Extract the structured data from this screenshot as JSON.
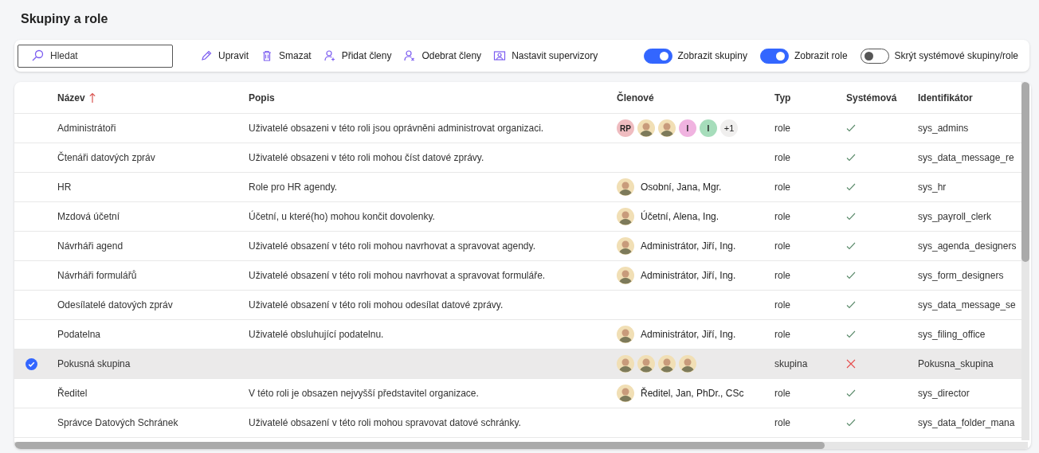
{
  "page": {
    "title": "Skupiny a role"
  },
  "toolbar": {
    "search": {
      "placeholder": "Hledat"
    },
    "actions": [
      {
        "kind": "edit",
        "label": "Upravit"
      },
      {
        "kind": "delete",
        "label": "Smazat"
      },
      {
        "kind": "add_members",
        "label": "Přidat členy"
      },
      {
        "kind": "remove_members",
        "label": "Odebrat členy"
      },
      {
        "kind": "supervisors",
        "label": "Nastavit supervizory"
      }
    ],
    "toggles": [
      {
        "label": "Zobrazit skupiny",
        "on": true
      },
      {
        "label": "Zobrazit role",
        "on": true
      },
      {
        "label": "Skrýt systémové skupiny/role",
        "on": false
      }
    ]
  },
  "table": {
    "columns": [
      {
        "label": "Název",
        "sorted": true
      },
      {
        "label": "Popis",
        "sorted": false
      },
      {
        "label": "Členové",
        "sorted": false
      },
      {
        "label": "Typ",
        "sorted": false
      },
      {
        "label": "Systémová",
        "sorted": false
      },
      {
        "label": "Identifikátor",
        "sorted": false
      }
    ],
    "rows": [
      {
        "selected": false,
        "name": "Administrátoři",
        "description": "Uživatelé obsazeni v této roli jsou oprávněni administrovat organizaci.",
        "members": [
          {
            "kind": "initials",
            "text": "RP",
            "color": "#efbcc0"
          },
          {
            "kind": "photo"
          },
          {
            "kind": "photo"
          },
          {
            "kind": "initials",
            "text": "I",
            "color": "#f0b3e0"
          },
          {
            "kind": "initials",
            "text": "I",
            "color": "#a6ddbb"
          },
          {
            "kind": "more",
            "text": "+1"
          }
        ],
        "type": "role",
        "system": true,
        "identifier": "sys_admins"
      },
      {
        "selected": false,
        "name": "Čtenáři datových zpráv",
        "description": "Uživatelé obsazeni v této roli mohou číst datové zprávy.",
        "members": [],
        "type": "role",
        "system": true,
        "identifier": "sys_data_message_re"
      },
      {
        "selected": false,
        "name": "HR",
        "description": "Role pro HR agendy.",
        "members": [
          {
            "kind": "photo"
          }
        ],
        "member_name": "Osobní, Jana, Mgr.",
        "type": "role",
        "system": true,
        "identifier": "sys_hr"
      },
      {
        "selected": false,
        "name": "Mzdová účetní",
        "description": "Účetní, u které(ho) mohou končit dovolenky.",
        "members": [
          {
            "kind": "photo"
          }
        ],
        "member_name": "Účetní, Alena, Ing.",
        "type": "role",
        "system": true,
        "identifier": "sys_payroll_clerk"
      },
      {
        "selected": false,
        "name": "Návrháři agend",
        "description": "Uživatelé obsazení v této roli mohou navrhovat a spravovat agendy.",
        "members": [
          {
            "kind": "photo"
          }
        ],
        "member_name": "Administrátor, Jiří, Ing.",
        "type": "role",
        "system": true,
        "identifier": "sys_agenda_designers"
      },
      {
        "selected": false,
        "name": "Návrháři formulářů",
        "description": "Uživatelé obsazení v této roli mohou navrhovat a spravovat formuláře.",
        "members": [
          {
            "kind": "photo"
          }
        ],
        "member_name": "Administrátor, Jiří, Ing.",
        "type": "role",
        "system": true,
        "identifier": "sys_form_designers"
      },
      {
        "selected": false,
        "name": "Odesílatelé datových zpráv",
        "description": "Uživatelé obsazení v této roli mohou odesílat datové zprávy.",
        "members": [],
        "type": "role",
        "system": true,
        "identifier": "sys_data_message_se"
      },
      {
        "selected": false,
        "name": "Podatelna",
        "description": "Uživatelé obsluhující podatelnu.",
        "members": [
          {
            "kind": "photo"
          }
        ],
        "member_name": "Administrátor, Jiří, Ing.",
        "type": "role",
        "system": true,
        "identifier": "sys_filing_office"
      },
      {
        "selected": true,
        "name": "Pokusná skupina",
        "members": [
          {
            "kind": "photo"
          },
          {
            "kind": "photo"
          },
          {
            "kind": "photo"
          },
          {
            "kind": "photo"
          }
        ],
        "type": "skupina",
        "system": false,
        "identifier": "Pokusna_skupina"
      },
      {
        "selected": false,
        "name": "Ředitel",
        "description": "V této roli je obsazen nejvyšší představitel organizace.",
        "members": [
          {
            "kind": "photo"
          }
        ],
        "member_name": "Ředitel, Jan, PhDr., CSc",
        "type": "role",
        "system": true,
        "identifier": "sys_director"
      },
      {
        "selected": false,
        "name": "Správce Datových Schránek",
        "description": "Uživatelé obsazení v této roli mohou spravovat datové schránky.",
        "members": [],
        "type": "role",
        "system": true,
        "identifier": "sys_data_folder_mana"
      }
    ]
  }
}
